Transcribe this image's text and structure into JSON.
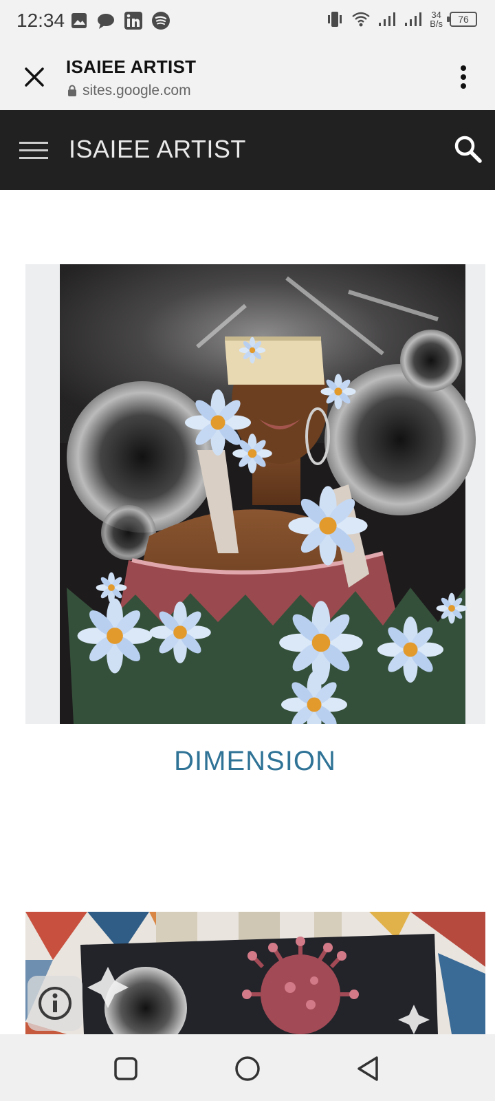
{
  "status_bar": {
    "time": "12:34",
    "left_icons": [
      "gallery-icon",
      "chat-bubble-icon",
      "linkedin-icon",
      "spotify-icon"
    ],
    "net_speed_value": "34",
    "net_speed_unit": "B/s",
    "battery": "76"
  },
  "custom_tab": {
    "title": "ISAIEE ARTIST",
    "url": "sites.google.com"
  },
  "site_header": {
    "title": "ISAIEE ARTIST"
  },
  "content": {
    "artworks": [
      {
        "caption": "DIMENSION"
      },
      {
        "caption": ""
      }
    ]
  },
  "colors": {
    "header_bg": "#212121",
    "caption": "#2f7396",
    "toolbar_bg": "#f2f2f2"
  }
}
